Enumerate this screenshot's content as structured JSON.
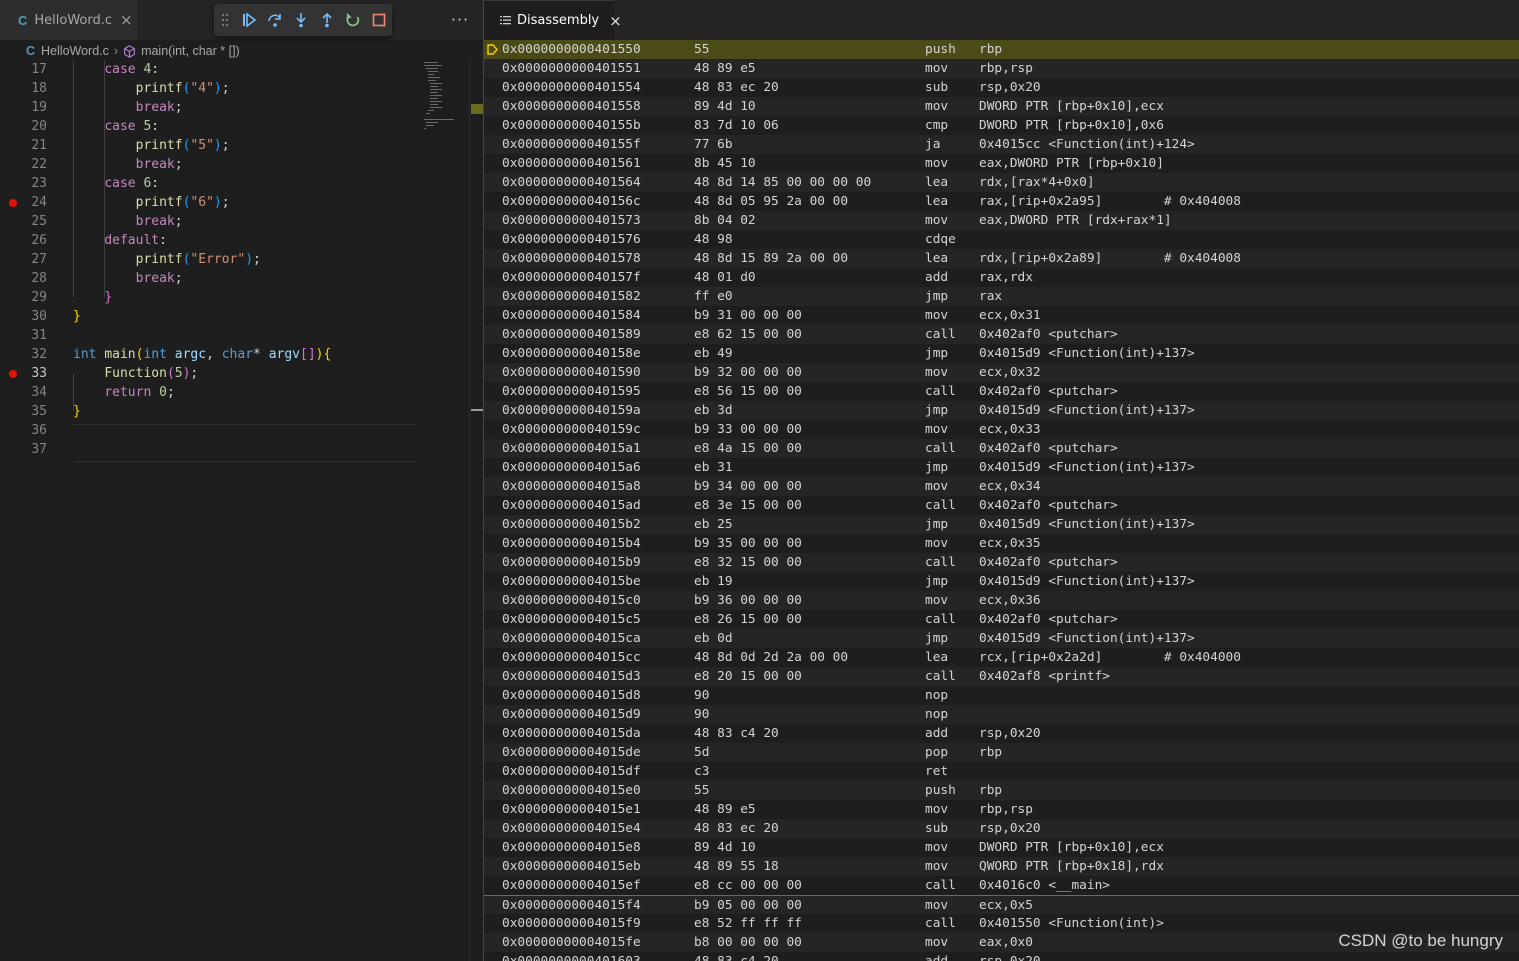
{
  "left_tab": {
    "icon": "C",
    "label": "HelloWord.c",
    "close": "×"
  },
  "debug_toolbar": {
    "buttons": [
      "grip-icon",
      "continue-icon",
      "step-over-icon",
      "step-into-icon",
      "step-out-icon",
      "restart-icon",
      "stop-icon"
    ],
    "accent": "#75beff",
    "stop_color": "#f48771"
  },
  "more_actions": "···",
  "breadcrumb": {
    "icon": "C",
    "file": "HelloWord.c",
    "symbol": "main(int, char * [])"
  },
  "code": {
    "current_line": 33,
    "breakpoints": [
      24,
      33
    ],
    "breakpoint_color": "#e51400",
    "lines": [
      {
        "n": "17",
        "tokens": [
          [
            "    ",
            ""
          ],
          [
            "case",
            "ctl"
          ],
          [
            " ",
            ""
          ],
          [
            "4",
            "num"
          ],
          [
            ":",
            ""
          ]
        ]
      },
      {
        "n": "18",
        "tokens": [
          [
            "        ",
            ""
          ],
          [
            "printf",
            "fn"
          ],
          [
            "(",
            "br3"
          ],
          [
            "\"4\"",
            "str"
          ],
          [
            ")",
            "br3"
          ],
          [
            ";",
            ""
          ]
        ]
      },
      {
        "n": "19",
        "tokens": [
          [
            "        ",
            ""
          ],
          [
            "break",
            "ctl"
          ],
          [
            ";",
            ""
          ]
        ]
      },
      {
        "n": "20",
        "tokens": [
          [
            "    ",
            ""
          ],
          [
            "case",
            "ctl"
          ],
          [
            " ",
            ""
          ],
          [
            "5",
            "num"
          ],
          [
            ":",
            ""
          ]
        ]
      },
      {
        "n": "21",
        "tokens": [
          [
            "        ",
            ""
          ],
          [
            "printf",
            "fn"
          ],
          [
            "(",
            "br3"
          ],
          [
            "\"5\"",
            "str"
          ],
          [
            ")",
            "br3"
          ],
          [
            ";",
            ""
          ]
        ]
      },
      {
        "n": "22",
        "tokens": [
          [
            "        ",
            ""
          ],
          [
            "break",
            "ctl"
          ],
          [
            ";",
            ""
          ]
        ]
      },
      {
        "n": "23",
        "tokens": [
          [
            "    ",
            ""
          ],
          [
            "case",
            "ctl"
          ],
          [
            " ",
            ""
          ],
          [
            "6",
            "num"
          ],
          [
            ":",
            ""
          ]
        ]
      },
      {
        "n": "24",
        "tokens": [
          [
            "        ",
            ""
          ],
          [
            "printf",
            "fn"
          ],
          [
            "(",
            "br3"
          ],
          [
            "\"6\"",
            "str"
          ],
          [
            ")",
            "br3"
          ],
          [
            ";",
            ""
          ]
        ]
      },
      {
        "n": "25",
        "tokens": [
          [
            "        ",
            ""
          ],
          [
            "break",
            "ctl"
          ],
          [
            ";",
            ""
          ]
        ]
      },
      {
        "n": "26",
        "tokens": [
          [
            "    ",
            ""
          ],
          [
            "default",
            "ctl"
          ],
          [
            ":",
            ""
          ]
        ]
      },
      {
        "n": "27",
        "tokens": [
          [
            "        ",
            ""
          ],
          [
            "printf",
            "fn"
          ],
          [
            "(",
            "br3"
          ],
          [
            "\"Error\"",
            "str"
          ],
          [
            ")",
            "br3"
          ],
          [
            ";",
            ""
          ]
        ]
      },
      {
        "n": "28",
        "tokens": [
          [
            "        ",
            ""
          ],
          [
            "break",
            "ctl"
          ],
          [
            ";",
            ""
          ]
        ]
      },
      {
        "n": "29",
        "tokens": [
          [
            "    ",
            ""
          ],
          [
            "}",
            "br2"
          ]
        ]
      },
      {
        "n": "30",
        "tokens": [
          [
            "}",
            "br1"
          ]
        ]
      },
      {
        "n": "31",
        "tokens": []
      },
      {
        "n": "32",
        "tokens": [
          [
            "int",
            "kw"
          ],
          [
            " ",
            ""
          ],
          [
            "main",
            "fn"
          ],
          [
            "(",
            "br1"
          ],
          [
            "int",
            "kw"
          ],
          [
            " ",
            ""
          ],
          [
            "argc",
            "prm"
          ],
          [
            ", ",
            ""
          ],
          [
            "char",
            "kw"
          ],
          [
            "* ",
            ""
          ],
          [
            "argv",
            "prm"
          ],
          [
            "[]",
            "br2"
          ],
          [
            ")",
            "br1"
          ],
          [
            "{",
            "br1"
          ]
        ]
      },
      {
        "n": "33",
        "tokens": [
          [
            "    ",
            ""
          ],
          [
            "Function",
            "fn"
          ],
          [
            "(",
            "br2"
          ],
          [
            "5",
            "num"
          ],
          [
            ")",
            "br2"
          ],
          [
            ";",
            ""
          ]
        ]
      },
      {
        "n": "34",
        "tokens": [
          [
            "    ",
            ""
          ],
          [
            "return",
            "ctl"
          ],
          [
            " ",
            ""
          ],
          [
            "0",
            "num"
          ],
          [
            ";",
            ""
          ]
        ]
      },
      {
        "n": "35",
        "tokens": [
          [
            "}",
            "br1"
          ]
        ]
      },
      {
        "n": "36",
        "tokens": []
      },
      {
        "n": "37",
        "tokens": []
      }
    ]
  },
  "disassembly_tab": {
    "label": "Disassembly",
    "close": "×"
  },
  "disassembly": {
    "instruction_pointer_row": 0,
    "focused_row": 45,
    "ip_color": "#ffcc00",
    "rows": [
      [
        "0x0000000000401550",
        "55",
        "push",
        "rbp"
      ],
      [
        "0x0000000000401551",
        "48 89 e5",
        "mov",
        "rbp,rsp"
      ],
      [
        "0x0000000000401554",
        "48 83 ec 20",
        "sub",
        "rsp,0x20"
      ],
      [
        "0x0000000000401558",
        "89 4d 10",
        "mov",
        "DWORD PTR [rbp+0x10],ecx"
      ],
      [
        "0x000000000040155b",
        "83 7d 10 06",
        "cmp",
        "DWORD PTR [rbp+0x10],0x6"
      ],
      [
        "0x000000000040155f",
        "77 6b",
        "ja",
        "0x4015cc <Function(int)+124>"
      ],
      [
        "0x0000000000401561",
        "8b 45 10",
        "mov",
        "eax,DWORD PTR [rbp+0x10]"
      ],
      [
        "0x0000000000401564",
        "48 8d 14 85 00 00 00 00",
        "lea",
        "rdx,[rax*4+0x0]"
      ],
      [
        "0x000000000040156c",
        "48 8d 05 95 2a 00 00",
        "lea",
        "rax,[rip+0x2a95]        # 0x404008"
      ],
      [
        "0x0000000000401573",
        "8b 04 02",
        "mov",
        "eax,DWORD PTR [rdx+rax*1]"
      ],
      [
        "0x0000000000401576",
        "48 98",
        "cdqe",
        ""
      ],
      [
        "0x0000000000401578",
        "48 8d 15 89 2a 00 00",
        "lea",
        "rdx,[rip+0x2a89]        # 0x404008"
      ],
      [
        "0x000000000040157f",
        "48 01 d0",
        "add",
        "rax,rdx"
      ],
      [
        "0x0000000000401582",
        "ff e0",
        "jmp",
        "rax"
      ],
      [
        "0x0000000000401584",
        "b9 31 00 00 00",
        "mov",
        "ecx,0x31"
      ],
      [
        "0x0000000000401589",
        "e8 62 15 00 00",
        "call",
        "0x402af0 <putchar>"
      ],
      [
        "0x000000000040158e",
        "eb 49",
        "jmp",
        "0x4015d9 <Function(int)+137>"
      ],
      [
        "0x0000000000401590",
        "b9 32 00 00 00",
        "mov",
        "ecx,0x32"
      ],
      [
        "0x0000000000401595",
        "e8 56 15 00 00",
        "call",
        "0x402af0 <putchar>"
      ],
      [
        "0x000000000040159a",
        "eb 3d",
        "jmp",
        "0x4015d9 <Function(int)+137>"
      ],
      [
        "0x000000000040159c",
        "b9 33 00 00 00",
        "mov",
        "ecx,0x33"
      ],
      [
        "0x00000000004015a1",
        "e8 4a 15 00 00",
        "call",
        "0x402af0 <putchar>"
      ],
      [
        "0x00000000004015a6",
        "eb 31",
        "jmp",
        "0x4015d9 <Function(int)+137>"
      ],
      [
        "0x00000000004015a8",
        "b9 34 00 00 00",
        "mov",
        "ecx,0x34"
      ],
      [
        "0x00000000004015ad",
        "e8 3e 15 00 00",
        "call",
        "0x402af0 <putchar>"
      ],
      [
        "0x00000000004015b2",
        "eb 25",
        "jmp",
        "0x4015d9 <Function(int)+137>"
      ],
      [
        "0x00000000004015b4",
        "b9 35 00 00 00",
        "mov",
        "ecx,0x35"
      ],
      [
        "0x00000000004015b9",
        "e8 32 15 00 00",
        "call",
        "0x402af0 <putchar>"
      ],
      [
        "0x00000000004015be",
        "eb 19",
        "jmp",
        "0x4015d9 <Function(int)+137>"
      ],
      [
        "0x00000000004015c0",
        "b9 36 00 00 00",
        "mov",
        "ecx,0x36"
      ],
      [
        "0x00000000004015c5",
        "e8 26 15 00 00",
        "call",
        "0x402af0 <putchar>"
      ],
      [
        "0x00000000004015ca",
        "eb 0d",
        "jmp",
        "0x4015d9 <Function(int)+137>"
      ],
      [
        "0x00000000004015cc",
        "48 8d 0d 2d 2a 00 00",
        "lea",
        "rcx,[rip+0x2a2d]        # 0x404000"
      ],
      [
        "0x00000000004015d3",
        "e8 20 15 00 00",
        "call",
        "0x402af8 <printf>"
      ],
      [
        "0x00000000004015d8",
        "90",
        "nop",
        ""
      ],
      [
        "0x00000000004015d9",
        "90",
        "nop",
        ""
      ],
      [
        "0x00000000004015da",
        "48 83 c4 20",
        "add",
        "rsp,0x20"
      ],
      [
        "0x00000000004015de",
        "5d",
        "pop",
        "rbp"
      ],
      [
        "0x00000000004015df",
        "c3",
        "ret",
        ""
      ],
      [
        "0x00000000004015e0",
        "55",
        "push",
        "rbp"
      ],
      [
        "0x00000000004015e1",
        "48 89 e5",
        "mov",
        "rbp,rsp"
      ],
      [
        "0x00000000004015e4",
        "48 83 ec 20",
        "sub",
        "rsp,0x20"
      ],
      [
        "0x00000000004015e8",
        "89 4d 10",
        "mov",
        "DWORD PTR [rbp+0x10],ecx"
      ],
      [
        "0x00000000004015eb",
        "48 89 55 18",
        "mov",
        "QWORD PTR [rbp+0x18],rdx"
      ],
      [
        "0x00000000004015ef",
        "e8 cc 00 00 00",
        "call",
        "0x4016c0 <__main>"
      ],
      [
        "0x00000000004015f4",
        "b9 05 00 00 00",
        "mov",
        "ecx,0x5"
      ],
      [
        "0x00000000004015f9",
        "e8 52 ff ff ff",
        "call",
        "0x401550 <Function(int)>"
      ],
      [
        "0x00000000004015fe",
        "b8 00 00 00 00",
        "mov",
        "eax,0x0"
      ],
      [
        "0x0000000000401603",
        "48 83 c4 20",
        "add",
        "rsp,0x20"
      ]
    ]
  },
  "watermark": "CSDN @to be hungry"
}
